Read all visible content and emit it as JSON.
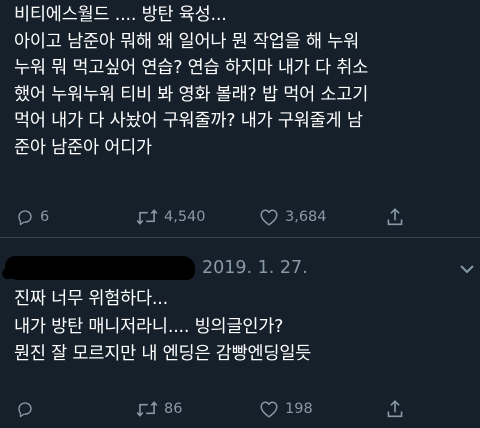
{
  "tweets": [
    {
      "text": "비티에스월드 .... 방탄 육성...\n아이고 남준아 뭐해 왜 일어나 뭔 작업을 해 누워\n누워 뭐 먹고싶어 연습? 연습 하지마 내가 다 취소\n했어 누워누워 티비 봐 영화 볼래? 밥 먹어 소고기\n먹어 내가 다 사놨어 구워줄까? 내가 구워줄게 남\n준아 남준아 어디가",
      "reply_count": "6",
      "retweet_count": "4,540",
      "like_count": "3,684"
    },
    {
      "timestamp": "2019. 1. 27.",
      "text": "진짜 너무 위험하다...\n내가 방탄 매니저라니.... 빙의글인가?\n뭔진 잘 모르지만 내 엔딩은 감빵엔딩일듯",
      "reply_count": "",
      "retweet_count": "86",
      "like_count": "198"
    }
  ],
  "icons": {
    "reply": "reply-icon",
    "retweet": "retweet-icon",
    "like": "heart-icon",
    "share": "share-icon",
    "more": "chevron-down-icon"
  },
  "colors": {
    "background": "#15202b",
    "text": "#ffffff",
    "muted": "#8899a6",
    "divider": "#38444d",
    "redaction": "#000000"
  }
}
